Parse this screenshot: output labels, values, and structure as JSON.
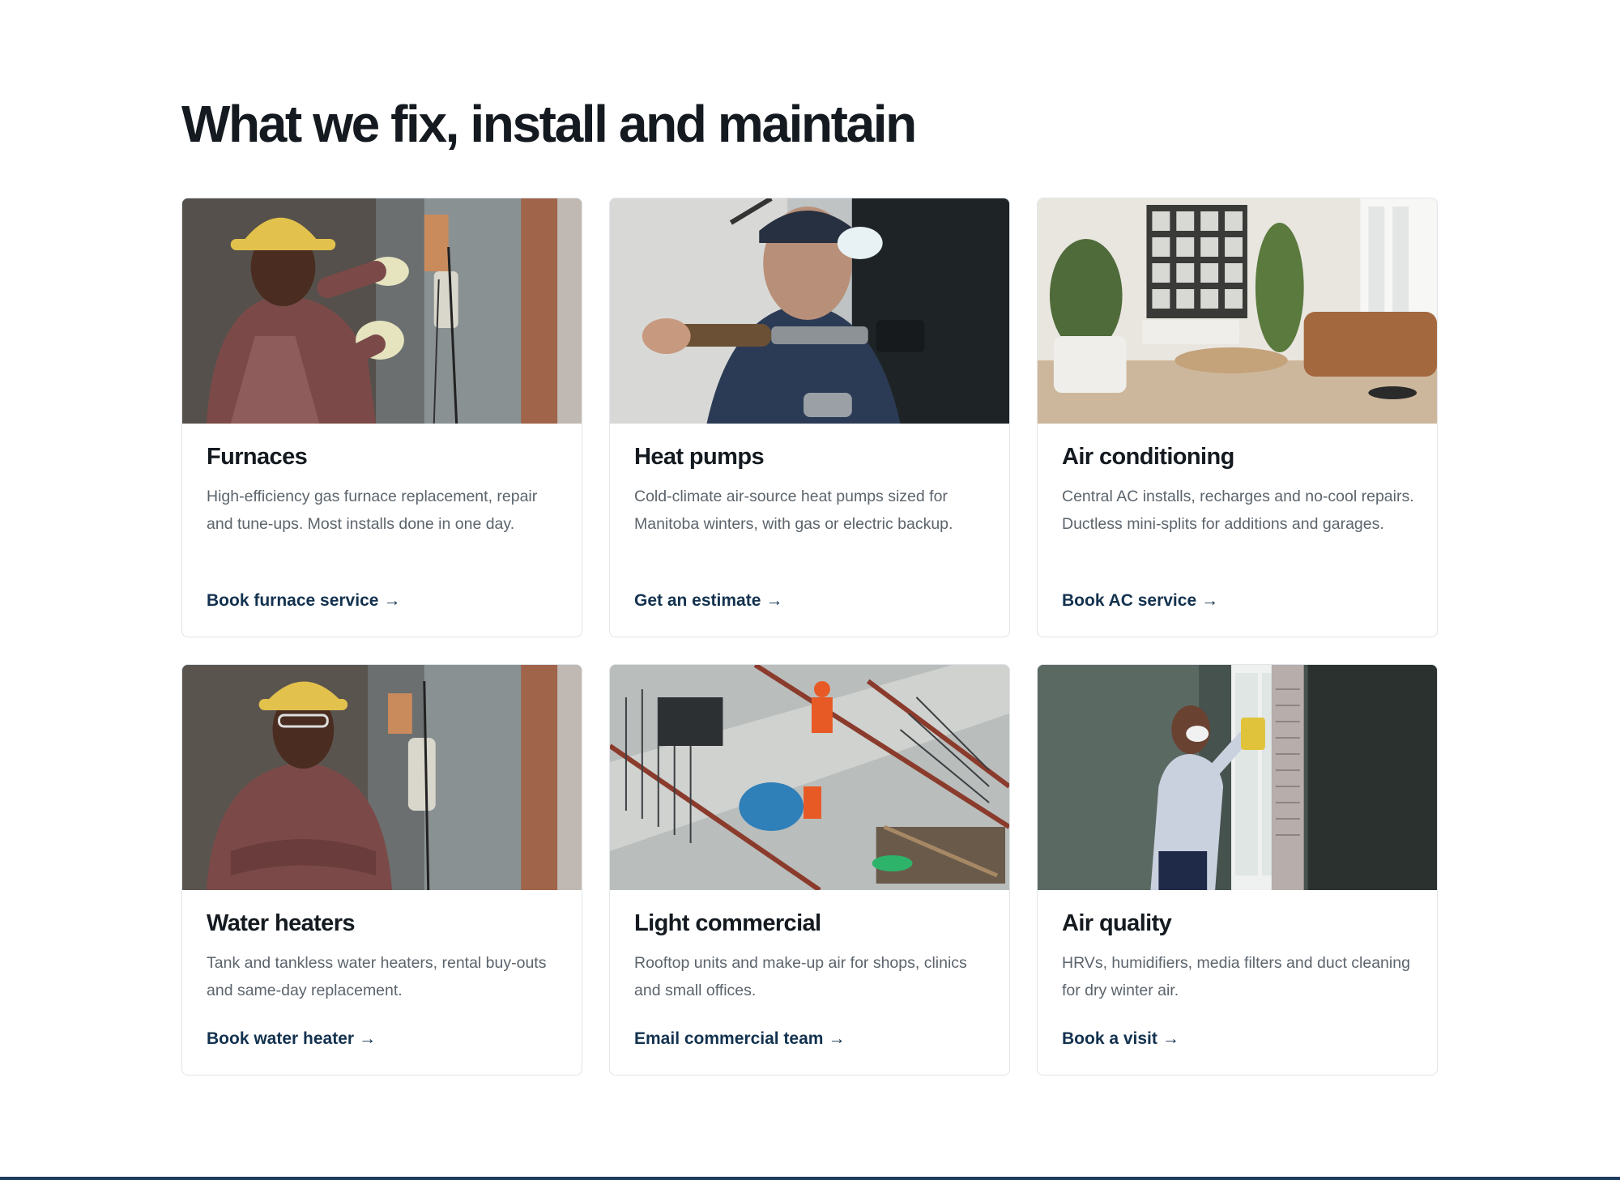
{
  "section": {
    "title": "What we fix, install and maintain"
  },
  "cards": [
    {
      "title": "Furnaces",
      "description": "High-efficiency gas furnace replacement, repair and tune-ups. Most installs done in one day.",
      "link": "Book furnace service",
      "arrow": "→",
      "image_icon": "technician-wiring-image"
    },
    {
      "title": "Heat pumps",
      "description": "Cold-climate air-source heat pumps sized for Manitoba winters, with gas or electric backup.",
      "link": "Get an estimate",
      "arrow": "→",
      "image_icon": "technician-torch-image"
    },
    {
      "title": "Air conditioning",
      "description": "Central AC installs, recharges and no-cool repairs. Ductless mini-splits for additions and garages.",
      "link": "Book AC service",
      "arrow": "→",
      "image_icon": "living-room-image"
    },
    {
      "title": "Water heaters",
      "description": "Tank and tankless water heaters, rental buy-outs and same-day replacement.",
      "link": "Book water heater",
      "arrow": "→",
      "image_icon": "technician-portrait-image"
    },
    {
      "title": "Light commercial",
      "description": "Rooftop units and make-up air for shops, clinics and small offices.",
      "link": "Email commercial team",
      "arrow": "→",
      "image_icon": "construction-site-image"
    },
    {
      "title": "Air quality",
      "description": "HRVs, humidifiers, media filters and duct cleaning for dry winter air.",
      "link": "Book a visit",
      "arrow": "→",
      "image_icon": "window-cleaning-image"
    }
  ],
  "colors": {
    "heading": "#141a20",
    "body_text": "#5c646c",
    "link": "#13324f",
    "card_border": "#e1e4e8"
  }
}
